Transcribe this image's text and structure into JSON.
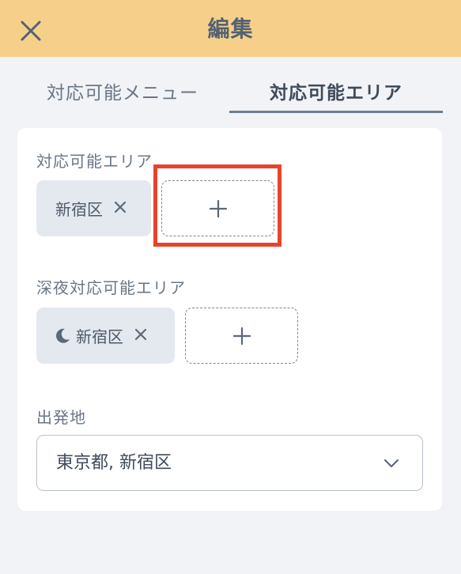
{
  "header": {
    "title": "編集",
    "close_icon": "close-icon"
  },
  "tabs": [
    {
      "label": "対応可能メニュー",
      "active": false
    },
    {
      "label": "対応可能エリア",
      "active": true
    }
  ],
  "card": {
    "area_section": {
      "label": "対応可能エリア",
      "chips": [
        {
          "label": "新宿区",
          "remove_icon": "close-icon"
        }
      ],
      "add_icon": "plus-icon",
      "add_highlighted": true
    },
    "night_section": {
      "label": "深夜対応可能エリア",
      "chips": [
        {
          "label": "新宿区",
          "leading_icon": "moon-icon",
          "remove_icon": "close-icon"
        }
      ],
      "add_icon": "plus-icon"
    },
    "departure": {
      "label": "出発地",
      "value": "東京都, 新宿区",
      "dropdown_icon": "chevron-down-icon"
    }
  },
  "colors": {
    "header_bg": "#f6d08a",
    "page_bg": "#f1f3f6",
    "chip_bg": "#e4e9ef",
    "highlight": "#e8432d",
    "active_tab_underline": "#6c7d90"
  }
}
